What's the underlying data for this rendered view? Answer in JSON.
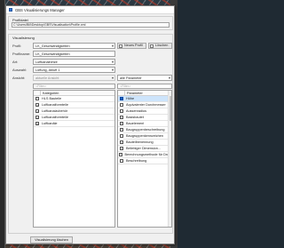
{
  "window": {
    "title": "GBS Visualisierungs Manager"
  },
  "profile_file": {
    "label": "Profildatei",
    "path": "C:\\Users\\Bill\\Desktop\\GBS\\Visualisation\\Profile.xml"
  },
  "visualization": {
    "label": "Visualisierung",
    "profil": {
      "label": "Profil:",
      "value": "LK_Geschwindigkeiten"
    },
    "profilname": {
      "label": "Profilname:",
      "value": "LK_Geschwindigkeiten"
    },
    "art": {
      "label": "Art:",
      "value": "Luftkanalnetze"
    },
    "auswahl": {
      "label": "Auswahl:",
      "value": "Lüftung, Abluft 1"
    },
    "ansicht": {
      "label": "Ansicht:",
      "value": "aktuelle Ansicht",
      "param_value": "alle Parameter"
    },
    "buttons": {
      "new_profile": "Neues Profil",
      "delete": "Löschen"
    }
  },
  "filter_placeholder": "<Filter>",
  "categories": {
    "header": "Kategorien",
    "items": [
      {
        "label": "HLS Bauteile",
        "checked": false
      },
      {
        "label": "Luftkanalformteile",
        "checked": true
      },
      {
        "label": "Luftkanalzubehör",
        "checked": true
      },
      {
        "label": "Luftkanalformteile",
        "checked": true
      },
      {
        "label": "Luftkanäle",
        "checked": true
      }
    ]
  },
  "parameters": {
    "header": "Parameter",
    "items": [
      {
        "label": "Höhe",
        "selected": true
      },
      {
        "label": "Äquivalenter Durchmesser",
        "selected": false
      },
      {
        "label": "Aussenradius",
        "selected": false
      },
      {
        "label": "Basisbauteil",
        "selected": false
      },
      {
        "label": "Bauelement",
        "selected": false
      },
      {
        "label": "Baugruppenbeschreibung",
        "selected": false
      },
      {
        "label": "Baugruppenkennzeichen",
        "selected": false
      },
      {
        "label": "Bauteilbenennung",
        "selected": false
      },
      {
        "label": "Beliebiger Dimension...",
        "selected": false
      },
      {
        "label": "Berechnungsmethode für Druckverlust",
        "selected": false
      },
      {
        "label": "Beschreibung",
        "selected": false
      }
    ]
  },
  "footer": {
    "visualize_button": "Visualisierung löschen"
  },
  "colors": {
    "selection": "#cde4fb",
    "param_checkbox": "#1565c0"
  }
}
